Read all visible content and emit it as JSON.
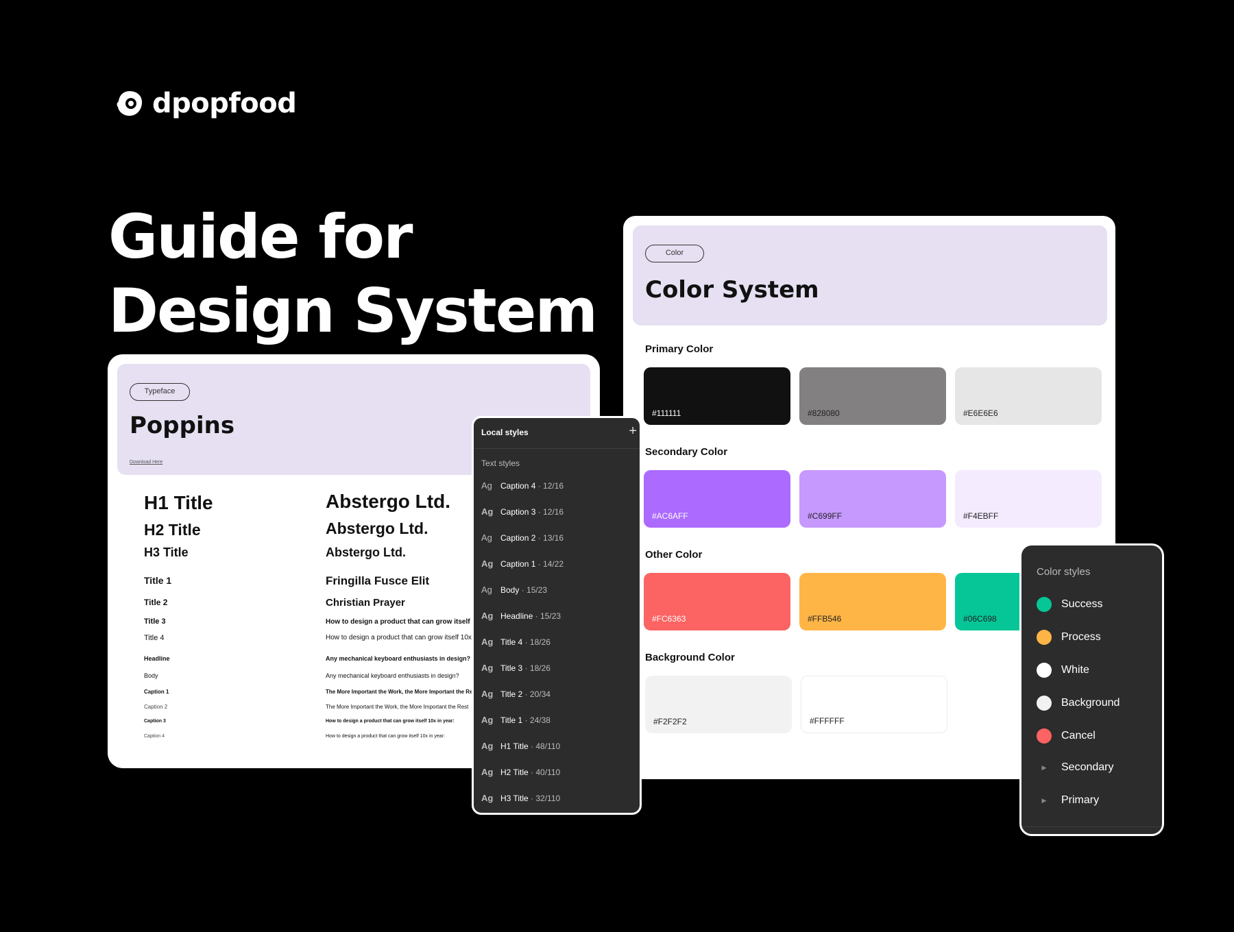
{
  "brand": {
    "name": "dpopfood"
  },
  "hero": {
    "line1": "Guide for",
    "line2": "Design System"
  },
  "typeface": {
    "tag": "Typeface",
    "title": "Poppins",
    "download": "Download Here",
    "left": [
      "H1 Title",
      "H2 Title",
      "H3 Title",
      "Title 1",
      "Title 2",
      "Title 3",
      "Title 4",
      "Headline",
      "Body",
      "Caption 1",
      "Caption 2",
      "Caption 3",
      "Caption 4"
    ],
    "right": [
      "Abstergo Ltd.",
      "Abstergo Ltd.",
      "Abstergo Ltd.",
      "Fringilla Fusce Elit",
      "Christian Prayer",
      "How to design a product that can grow itself 10x in year:",
      "How to design a product that can grow itself 10x in year:",
      "Any mechanical keyboard enthusiasts in design?",
      "Any mechanical keyboard enthusiasts in design?",
      "The More Important the Work, the More Important the Rest",
      "The More Important the Work, the More Important the Rest",
      "How to design a product that can grow itself 10x in year:",
      "How to design a product that can grow itself 10x in year:"
    ]
  },
  "local_styles": {
    "title": "Local styles",
    "plus": "+",
    "section": "Text styles",
    "items": [
      {
        "ag": "Ag",
        "name": "Caption 4",
        "size": " · 12/16"
      },
      {
        "ag": "Ag",
        "name": "Caption 3",
        "size": " · 12/16"
      },
      {
        "ag": "Ag",
        "name": "Caption 2",
        "size": " · 13/16"
      },
      {
        "ag": "Ag",
        "name": "Caption 1",
        "size": " · 14/22"
      },
      {
        "ag": "Ag",
        "name": "Body",
        "size": " · 15/23"
      },
      {
        "ag": "Ag",
        "name": "Headline",
        "size": " · 15/23"
      },
      {
        "ag": "Ag",
        "name": "Title 4",
        "size": " · 18/26"
      },
      {
        "ag": "Ag",
        "name": "Title 3",
        "size": " · 18/26"
      },
      {
        "ag": "Ag",
        "name": "Title 2",
        "size": " · 20/34"
      },
      {
        "ag": "Ag",
        "name": "Title 1",
        "size": " · 24/38"
      },
      {
        "ag": "Ag",
        "name": "H1 Title",
        "size": " · 48/110"
      },
      {
        "ag": "Ag",
        "name": "H2 Title",
        "size": " · 40/110"
      },
      {
        "ag": "Ag",
        "name": "H3 Title",
        "size": " · 32/110"
      }
    ]
  },
  "color_system": {
    "tag": "Color",
    "title": "Color System",
    "sections": [
      {
        "label": "Primary Color",
        "swatches": [
          {
            "hex": "#111111",
            "color": "#111111",
            "text": "#ffffff"
          },
          {
            "hex": "#828080",
            "color": "#828080",
            "text": "#222222"
          },
          {
            "hex": "#E6E6E6",
            "color": "#E6E6E6",
            "text": "#222222"
          }
        ]
      },
      {
        "label": "Secondary Color",
        "swatches": [
          {
            "hex": "#AC6AFF",
            "color": "#AC6AFF",
            "text": "#ffffff"
          },
          {
            "hex": "#C699FF",
            "color": "#C699FF",
            "text": "#222222"
          },
          {
            "hex": "#F4EBFF",
            "color": "#F4EBFF",
            "text": "#222222"
          }
        ]
      },
      {
        "label": "Other Color",
        "swatches": [
          {
            "hex": "#FC6363",
            "color": "#FC6363",
            "text": "#ffffff"
          },
          {
            "hex": "#FFB546",
            "color": "#FFB546",
            "text": "#222222"
          },
          {
            "hex": "#06C698",
            "color": "#06C698",
            "text": "#222222"
          }
        ]
      },
      {
        "label": "Background Color",
        "swatches": [
          {
            "hex": "#F2F2F2",
            "color": "#F2F2F2",
            "text": "#222222"
          },
          {
            "hex": "#FFFFFF",
            "color": "#FFFFFF",
            "text": "#222222"
          }
        ]
      }
    ]
  },
  "color_styles": {
    "title": "Color styles",
    "items": [
      {
        "name": "Success",
        "color": "#06C698",
        "kind": "dot"
      },
      {
        "name": "Process",
        "color": "#FFB546",
        "kind": "dot"
      },
      {
        "name": "White",
        "color": "#FFFFFF",
        "kind": "dot"
      },
      {
        "name": "Background",
        "color": "#F2F2F2",
        "kind": "dot"
      },
      {
        "name": "Cancel",
        "color": "#FC6363",
        "kind": "dot"
      },
      {
        "name": "Secondary",
        "color": "",
        "kind": "caret"
      },
      {
        "name": "Primary",
        "color": "",
        "kind": "caret"
      }
    ]
  }
}
